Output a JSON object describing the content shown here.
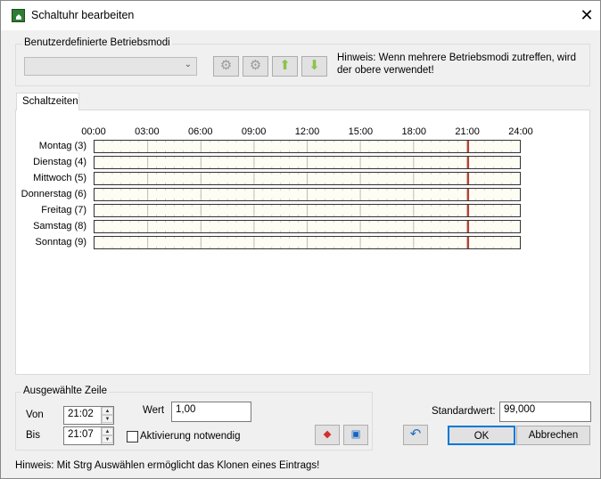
{
  "window": {
    "title": "Schaltuhr bearbeiten"
  },
  "modes": {
    "group_label": "Benutzerdefinierte Betriebsmodi",
    "selected": "",
    "hint": "Hinweis: Wenn mehrere Betriebsmodi zutreffen, wird der obere verwendet!"
  },
  "tabs": [
    {
      "label": "Schaltzeiten"
    }
  ],
  "schedule": {
    "hours": [
      "00:00",
      "03:00",
      "06:00",
      "09:00",
      "12:00",
      "15:00",
      "18:00",
      "21:00",
      "24:00"
    ],
    "days": [
      "Montag (3)",
      "Dienstag (4)",
      "Mittwoch (5)",
      "Donnerstag (6)",
      "Freitag (7)",
      "Samstag (8)",
      "Sonntag (9)"
    ],
    "marker_from_hours": 21.033,
    "marker_to_hours": 21.117,
    "marker_color": "#c0392b"
  },
  "selected_row": {
    "group_label": "Ausgewählte Zeile",
    "from_label": "Von",
    "from": "21:02",
    "to_label": "Bis",
    "to": "21:07",
    "value_label": "Wert",
    "value": "1,00",
    "activation_label": "Aktivierung notwendig",
    "activation_checked": false
  },
  "default": {
    "label": "Standardwert:",
    "value": "99,000"
  },
  "buttons": {
    "ok": "OK",
    "cancel": "Abbrechen"
  },
  "footer_hint": "Hinweis: Mit Strg Auswählen ermöglicht das Klonen eines Eintrags!"
}
